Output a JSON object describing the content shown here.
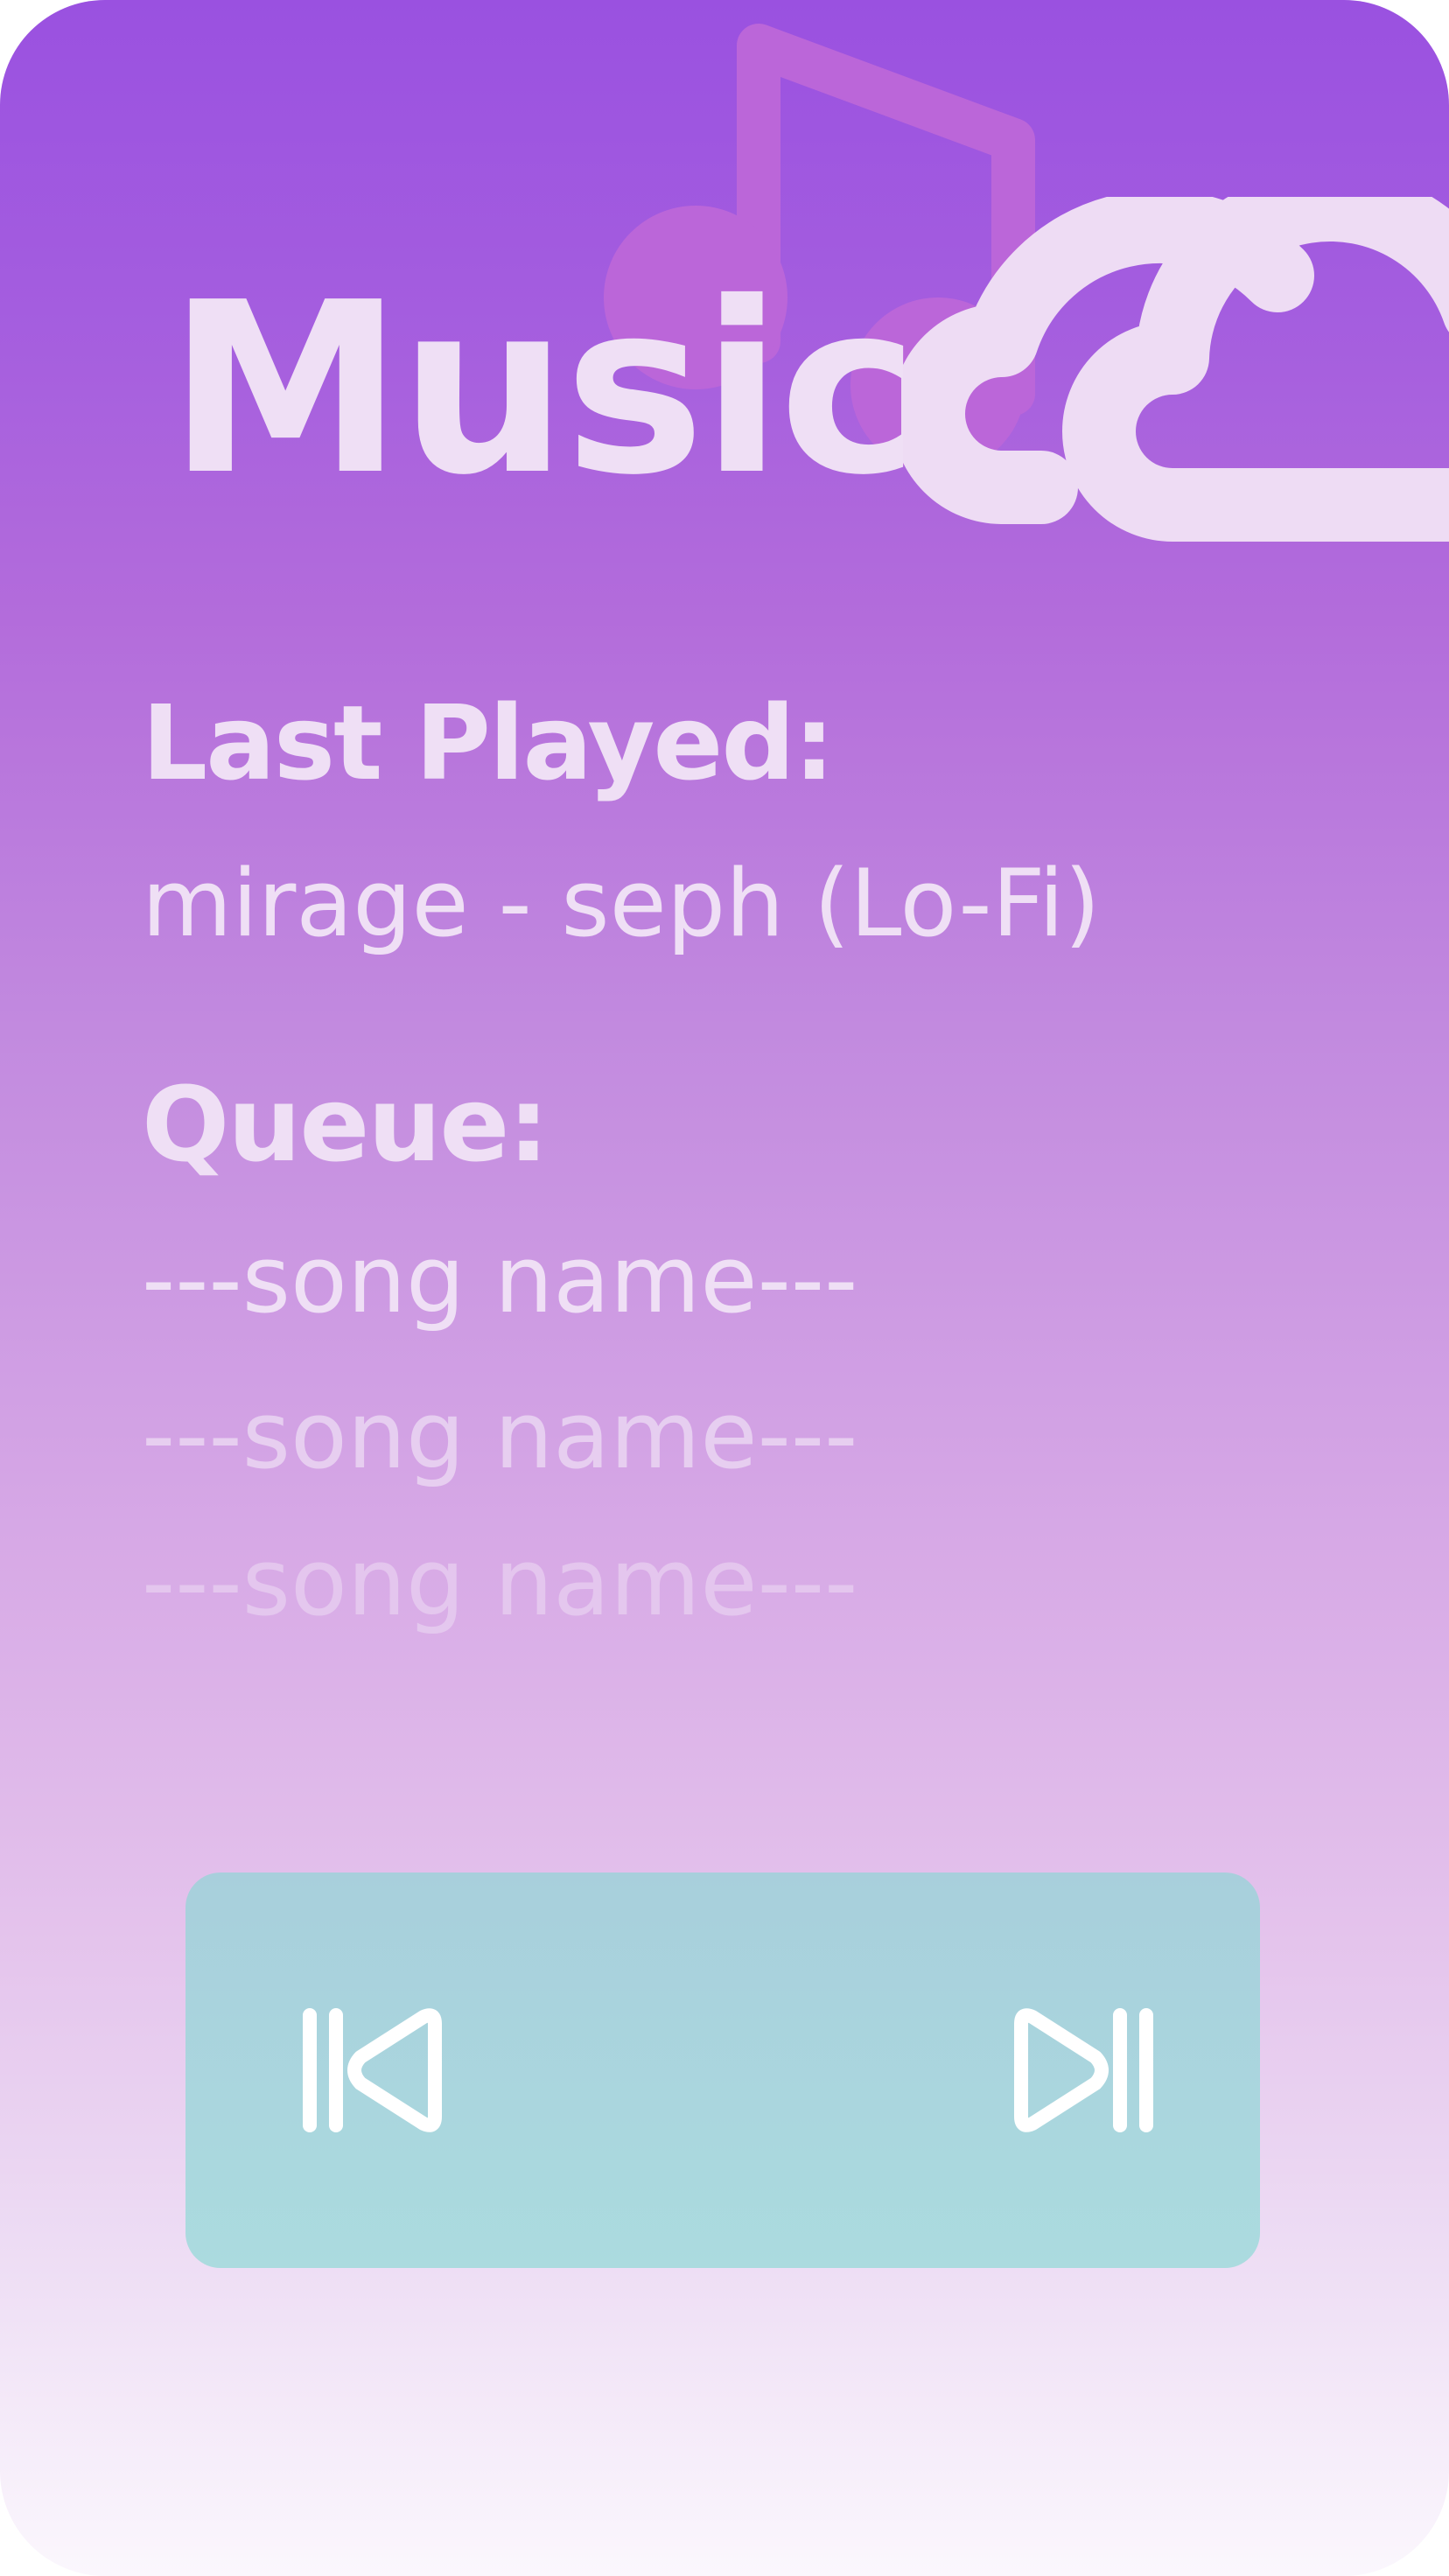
{
  "app": {
    "title": "Music"
  },
  "last_played": {
    "label": "Last Played:",
    "track": "mirage - seph (Lo-Fi)"
  },
  "queue": {
    "label": "Queue:",
    "items": [
      "---song name---",
      "---song name---",
      "---song name---"
    ]
  },
  "icons": {
    "background_note": "music-note-icon",
    "background_cloud": "cloud-icon",
    "previous": "skip-previous-icon",
    "next": "skip-next-icon"
  },
  "colors": {
    "gradient_top": "#9a51e0",
    "gradient_bottom": "#fbf7fd",
    "text": "#efdff5",
    "player_panel": "#a8cfdc",
    "control_icon": "#ffffff"
  }
}
